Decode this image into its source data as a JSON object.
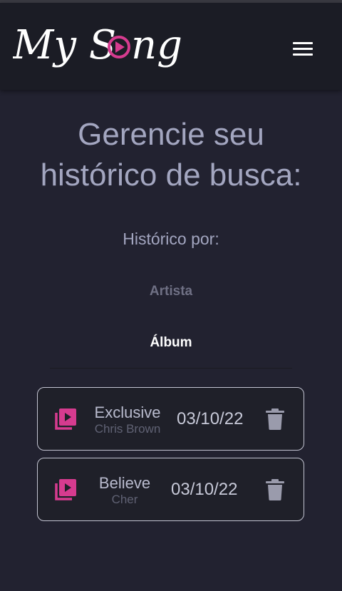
{
  "header": {
    "logo_text_part1": "My S",
    "logo_text_part2": "ng",
    "menu_icon": "hamburger-menu-icon"
  },
  "page": {
    "title_line1": "Gerencie seu",
    "title_line2": "histórico de busca:",
    "subtitle": "Histórico por:"
  },
  "tabs": {
    "artist": "Artista",
    "album": "Álbum",
    "active": "album"
  },
  "history": [
    {
      "name": "Exclusive",
      "artist": "Chris Brown",
      "date": "03/10/22",
      "icon": "album-play-icon",
      "action_icon": "trash-icon"
    },
    {
      "name": "Believe",
      "artist": "Cher",
      "date": "03/10/22",
      "icon": "album-play-icon",
      "action_icon": "trash-icon"
    }
  ],
  "colors": {
    "accent": "#d63b8f",
    "background": "#222230",
    "header": "#1b1c25"
  }
}
